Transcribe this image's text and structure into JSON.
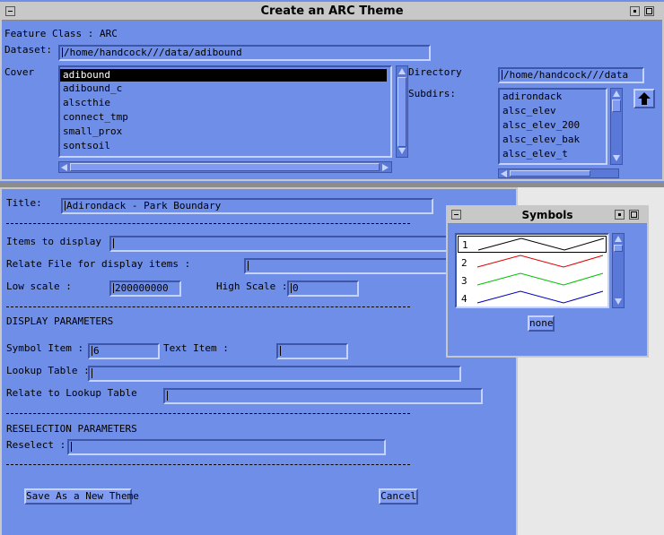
{
  "main_window": {
    "title": "Create an ARC Theme",
    "feature_class_label": "Feature Class : ARC",
    "dataset_label": "Dataset:",
    "dataset_value": "/home/handcock///data/adibound",
    "cover_label": "Cover",
    "cover_items": [
      "adibound",
      "adibound_c",
      "alscthie",
      "connect_tmp",
      "small_prox",
      "sontsoil"
    ],
    "cover_selected_index": 0,
    "directory_label": "Directory",
    "directory_value": "/home/handcock///data",
    "subdirs_label": "Subdirs:",
    "subdir_items": [
      "adirondack",
      "alsc_elev",
      "alsc_elev_200",
      "alsc_elev_bak",
      "alsc_elev_t"
    ],
    "up_icon": "up-arrow-icon"
  },
  "theme_window": {
    "title_label": "Title:",
    "title_value": "Adirondack - Park Boundary",
    "items_label": "Items to display :",
    "items_value": "",
    "relate_label": "Relate File for display items :",
    "relate_value": "",
    "low_scale_label": "Low scale :",
    "low_scale_value": "200000000",
    "high_scale_label": "High Scale :",
    "high_scale_value": "0",
    "display_params_heading": "DISPLAY PARAMETERS",
    "symbol_item_label": "Symbol Item :",
    "symbol_item_value": "6",
    "text_item_label": "Text Item :",
    "text_item_value": "",
    "lookup_label": "Lookup Table :",
    "lookup_value": "",
    "relate_lookup_label": "Relate to Lookup Table",
    "relate_lookup_value": "",
    "reselection_heading": "RESELECTION PARAMETERS",
    "reselect_label": "Reselect :",
    "reselect_value": "",
    "save_button": "Save As a New Theme",
    "cancel_button": "Cancel"
  },
  "symbols_window": {
    "title": "Symbols",
    "symbols": [
      {
        "label": "1",
        "color": "#000000"
      },
      {
        "label": "2",
        "color": "#e00000"
      },
      {
        "label": "3",
        "color": "#00c000"
      },
      {
        "label": "4",
        "color": "#0000c0"
      }
    ],
    "none_button": "none"
  }
}
